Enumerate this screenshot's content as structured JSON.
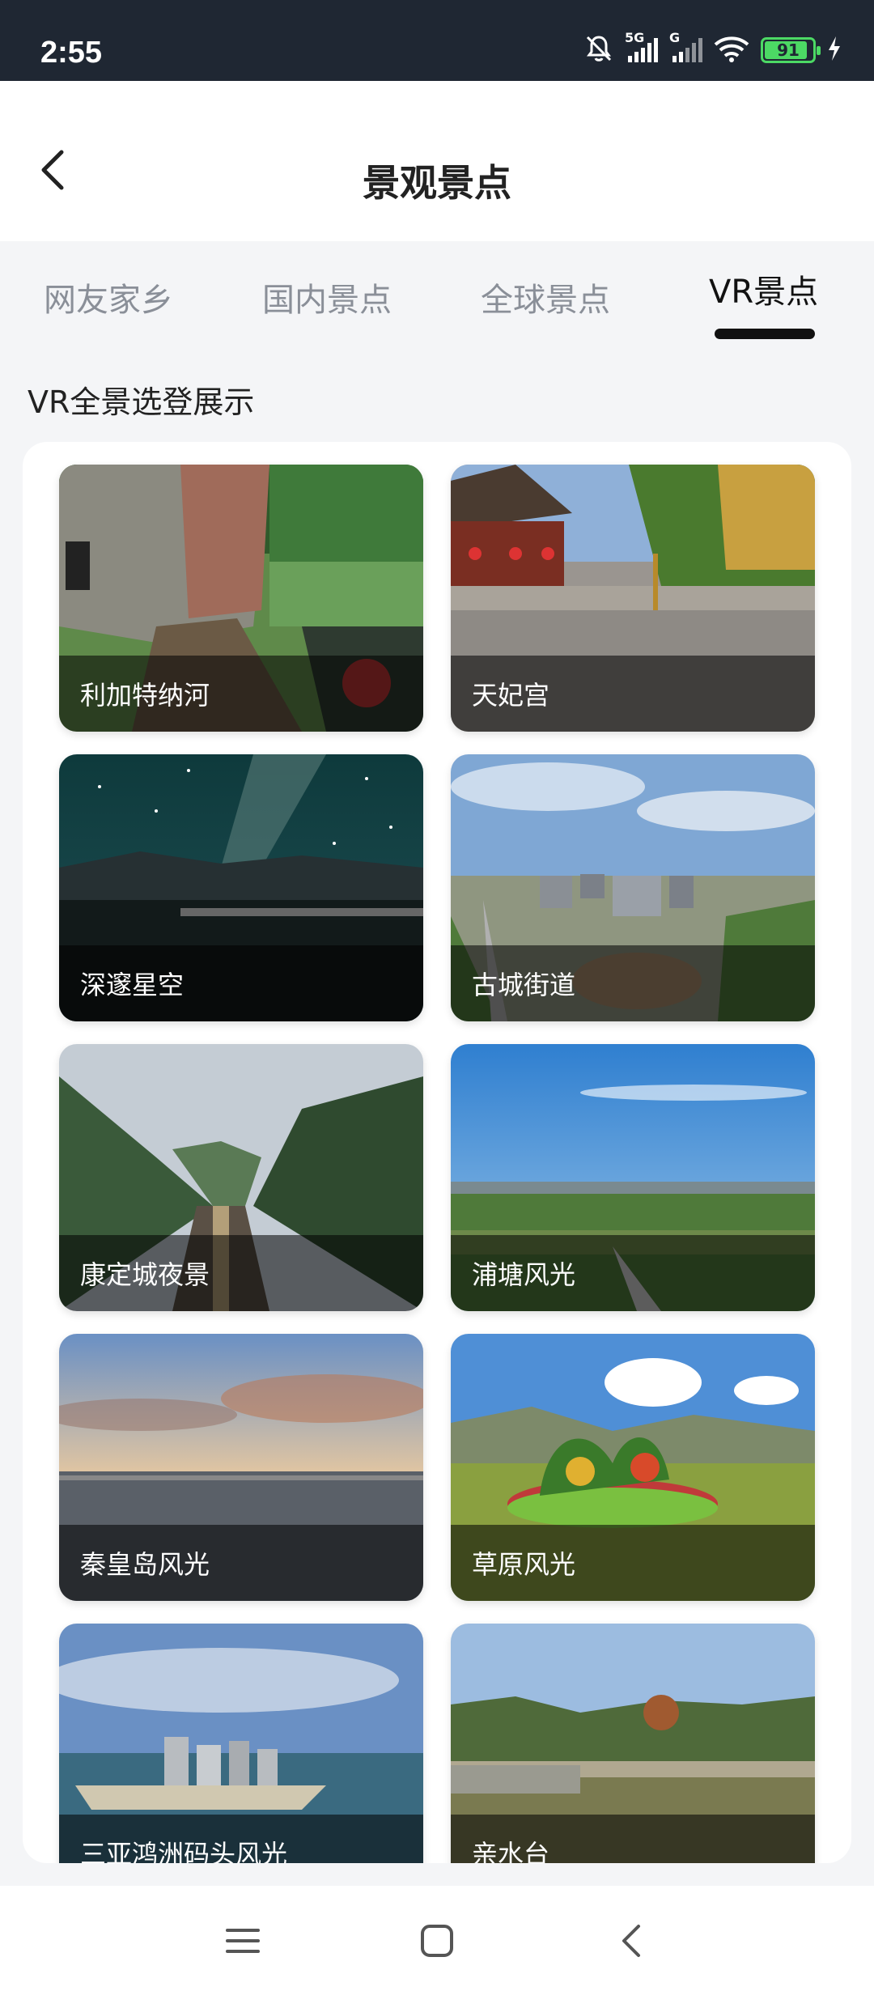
{
  "status_bar": {
    "time": "2:55",
    "network_primary": "5G",
    "network_secondary": "G",
    "battery": "91",
    "battery_level": 0.91
  },
  "header": {
    "title": "景观景点",
    "back_icon": "chevron-left-icon"
  },
  "tabs": [
    {
      "label": "网友家乡",
      "active": false
    },
    {
      "label": "国内景点",
      "active": false
    },
    {
      "label": "全球景点",
      "active": false
    },
    {
      "label": "VR景点",
      "active": true
    }
  ],
  "section_title": "VR全景选登展示",
  "spots": [
    {
      "label": "利加特纳河"
    },
    {
      "label": "天妃宫"
    },
    {
      "label": "深邃星空"
    },
    {
      "label": "古城街道"
    },
    {
      "label": "康定城夜景"
    },
    {
      "label": "浦塘风光"
    },
    {
      "label": "秦皇岛风光"
    },
    {
      "label": "草原风光"
    },
    {
      "label": "三亚鸿洲码头风光"
    },
    {
      "label": "亲水台"
    }
  ],
  "nav_bar": {
    "menu_icon": "menu-icon",
    "home_icon": "home-square-icon",
    "back_icon": "back-icon"
  },
  "colors": {
    "status_bar_bg": "#1f2733",
    "battery_green": "#4cd964",
    "active_tab": "#111111",
    "inactive_tab": "#8a8f98"
  }
}
